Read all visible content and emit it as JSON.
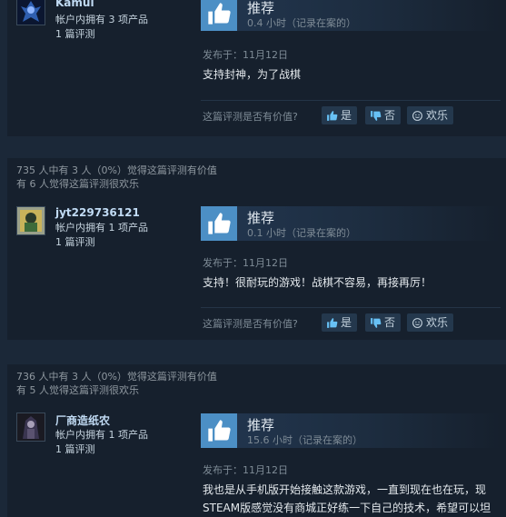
{
  "reviews": [
    {
      "helpful_line1": "",
      "helpful_line2": "",
      "author": "Kamui",
      "products": "帐户内拥有 3 项产品",
      "review_count": "1 篇评测",
      "recommendation": "推荐",
      "hours": "0.4 小时（记录在案的）",
      "posted": "发布于：11月12日",
      "text": "支持封神，为了战棋",
      "helpful_question": "这篇评测是否有价值?",
      "yes": "是",
      "no": "否",
      "funny": "欢乐"
    },
    {
      "helpful_line1": "735 人中有 3 人（0%）觉得这篇评测有价值",
      "helpful_line2": "有 6 人觉得这篇评测很欢乐",
      "author": "jyt229736121",
      "products": "帐户内拥有 1 项产品",
      "review_count": "1 篇评测",
      "recommendation": "推荐",
      "hours": "0.1 小时（记录在案的）",
      "posted": "发布于：11月12日",
      "text": "支持！很耐玩的游戏！战棋不容易，再接再厉！",
      "helpful_question": "这篇评测是否有价值?",
      "yes": "是",
      "no": "否",
      "funny": "欢乐"
    },
    {
      "helpful_line1": "736 人中有 3 人（0%）觉得这篇评测有价值",
      "helpful_line2": "有 5 人觉得这篇评测很欢乐",
      "author": "厂商造纸农",
      "products": "帐户内拥有 1 项产品",
      "review_count": "1 篇评测",
      "recommendation": "推荐",
      "hours": "15.6 小时（记录在案的）",
      "posted": "发布于：11月12日",
      "text": "我也是从手机版开始接触这款游戏，一直到现在也在玩，现\nSTEAM版感觉没有商城正好练一下自己的技术，希望可以坦",
      "helpful_question": "",
      "yes": "",
      "no": "",
      "funny": ""
    }
  ],
  "colors": {
    "thumb": "#4c8fc5",
    "author": "#c1dbf4",
    "card": "#16202d",
    "page": "#1b2838"
  },
  "icons": {
    "recommend": "thumbs-up-icon",
    "yes": "thumbs-up-icon",
    "no": "thumbs-down-icon",
    "funny": "smiley-icon"
  }
}
